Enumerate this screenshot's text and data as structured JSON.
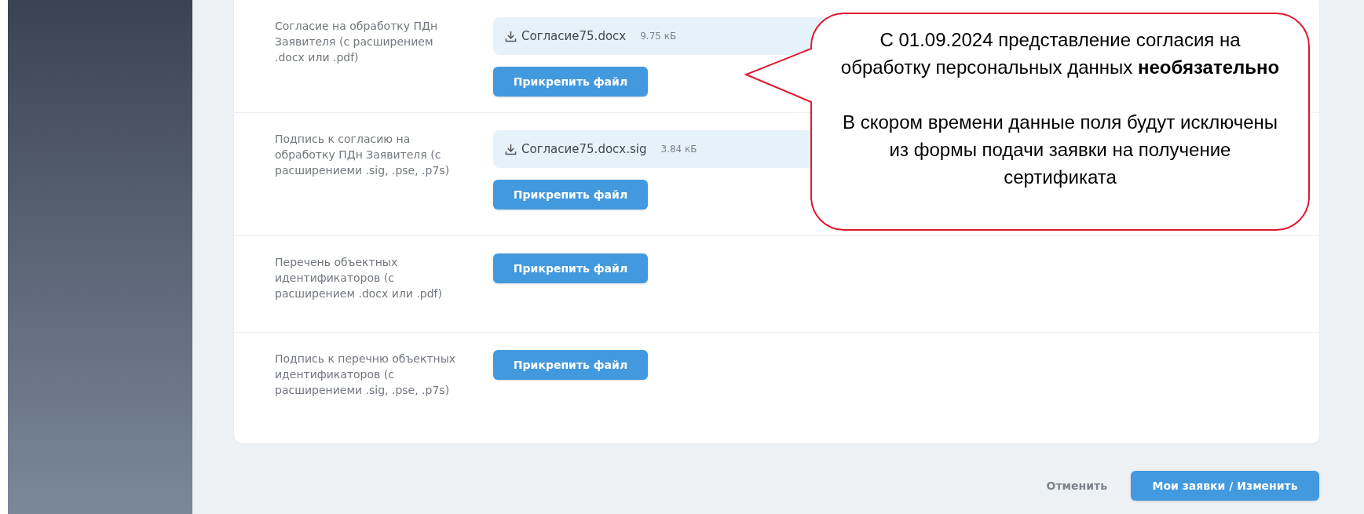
{
  "rows": [
    {
      "label": "Согласие на обработку ПДн Заявителя (с расширением .docx или .pdf)",
      "file": {
        "name": "Согласие75.docx",
        "size": "9.75 кБ"
      },
      "button": "Прикрепить файл"
    },
    {
      "label": "Подпись к согласию на обработку ПДн Заявителя (с расширениеми .sig, .pse, .p7s)",
      "file": {
        "name": "Согласие75.docx.sig",
        "size": "3.84 кБ"
      },
      "button": "Прикрепить файл"
    },
    {
      "label": "Перечень объектных идентификаторов (с расширением .docx или .pdf)",
      "button": "Прикрепить файл"
    },
    {
      "label": "Подпись к перечню объектных идентификаторов (с расширениеми .sig, .pse, .p7s)",
      "button": "Прикрепить файл"
    }
  ],
  "footer": {
    "cancel": "Отменить",
    "submit": "Мои заявки / Изменить"
  },
  "callout": {
    "paragraphs": [
      "С 01.09.2024 представление согласия на обработку персональных данных **необязательно**",
      "В скором времени данные поля будут исключены из формы подачи заявки на получение сертификата"
    ]
  }
}
